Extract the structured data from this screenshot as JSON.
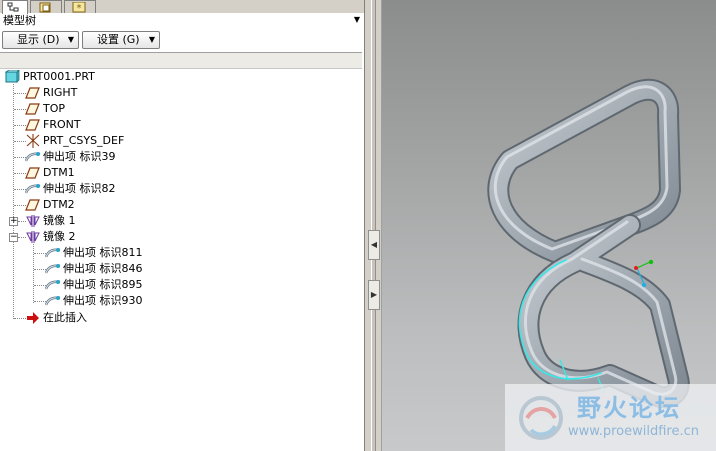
{
  "panel": {
    "title": "模型树",
    "show_button": "显示 (D)",
    "settings_button": "设置 (G)",
    "tabs": [
      "model-tree-tab",
      "folder-browser-tab",
      "favorites-tab"
    ]
  },
  "tree": {
    "root": "PRT0001.PRT",
    "items": [
      {
        "label": "RIGHT",
        "icon": "datum-plane-icon"
      },
      {
        "label": "TOP",
        "icon": "datum-plane-icon"
      },
      {
        "label": "FRONT",
        "icon": "datum-plane-icon"
      },
      {
        "label": "PRT_CSYS_DEF",
        "icon": "csys-icon"
      },
      {
        "label": "伸出项 标识39",
        "icon": "sweep-protrusion-icon"
      },
      {
        "label": "DTM1",
        "icon": "datum-plane-icon"
      },
      {
        "label": "伸出项 标识82",
        "icon": "sweep-protrusion-icon"
      },
      {
        "label": "DTM2",
        "icon": "datum-plane-icon"
      },
      {
        "label": "镜像 1",
        "icon": "mirror-icon",
        "expander": "+"
      },
      {
        "label": "镜像 2",
        "icon": "mirror-icon",
        "expander": "−"
      }
    ],
    "children": [
      {
        "label": "伸出项 标识811",
        "icon": "sweep-protrusion-icon"
      },
      {
        "label": "伸出项 标识846",
        "icon": "sweep-protrusion-icon"
      },
      {
        "label": "伸出项 标识895",
        "icon": "sweep-protrusion-icon"
      },
      {
        "label": "伸出项 标识930",
        "icon": "sweep-protrusion-icon"
      }
    ],
    "insert_here": "在此插入"
  },
  "watermark": {
    "title": "野火论坛",
    "url": "www.proewildfire.cn"
  },
  "colors": {
    "tube": "#9aa3ab",
    "selection_highlight": "#38e8e8",
    "insert_arrow": "#cc1010",
    "viewport_top": "#8b8d8c",
    "viewport_bottom": "#c8c9cb"
  }
}
